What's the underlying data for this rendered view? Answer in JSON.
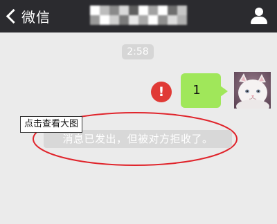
{
  "navbar": {
    "back_label": "微信",
    "title_mosaic": [
      "#ffffff",
      "#bdbdbd",
      "#8a8a8a",
      "#d9d9d9",
      "#5f5f5f",
      "#ffffff",
      "#a2a2a2",
      "#ffffff",
      "#6e6e6e",
      "#c6c6c6",
      "#9a9a9a",
      "#ffffff",
      "#cfcfcf",
      "#7b7b7b",
      "#e8e8e8",
      "#a8a8a8",
      "#ffffff",
      "#8f8f8f",
      "#dcdcdc",
      "#b0b0b0"
    ]
  },
  "chat": {
    "timestamp": "2:58",
    "message": {
      "text": "1",
      "status_icon_glyph": "!",
      "status_color": "#e03a36",
      "bubble_color": "#a0e75a"
    },
    "tooltip": "点击查看大图",
    "system_notice": "消息已发出，但被对方拒收了。"
  },
  "colors": {
    "navbar_bg": "#2b2b2f",
    "chat_bg": "#ebebeb",
    "annotation_red": "#e0242b"
  }
}
